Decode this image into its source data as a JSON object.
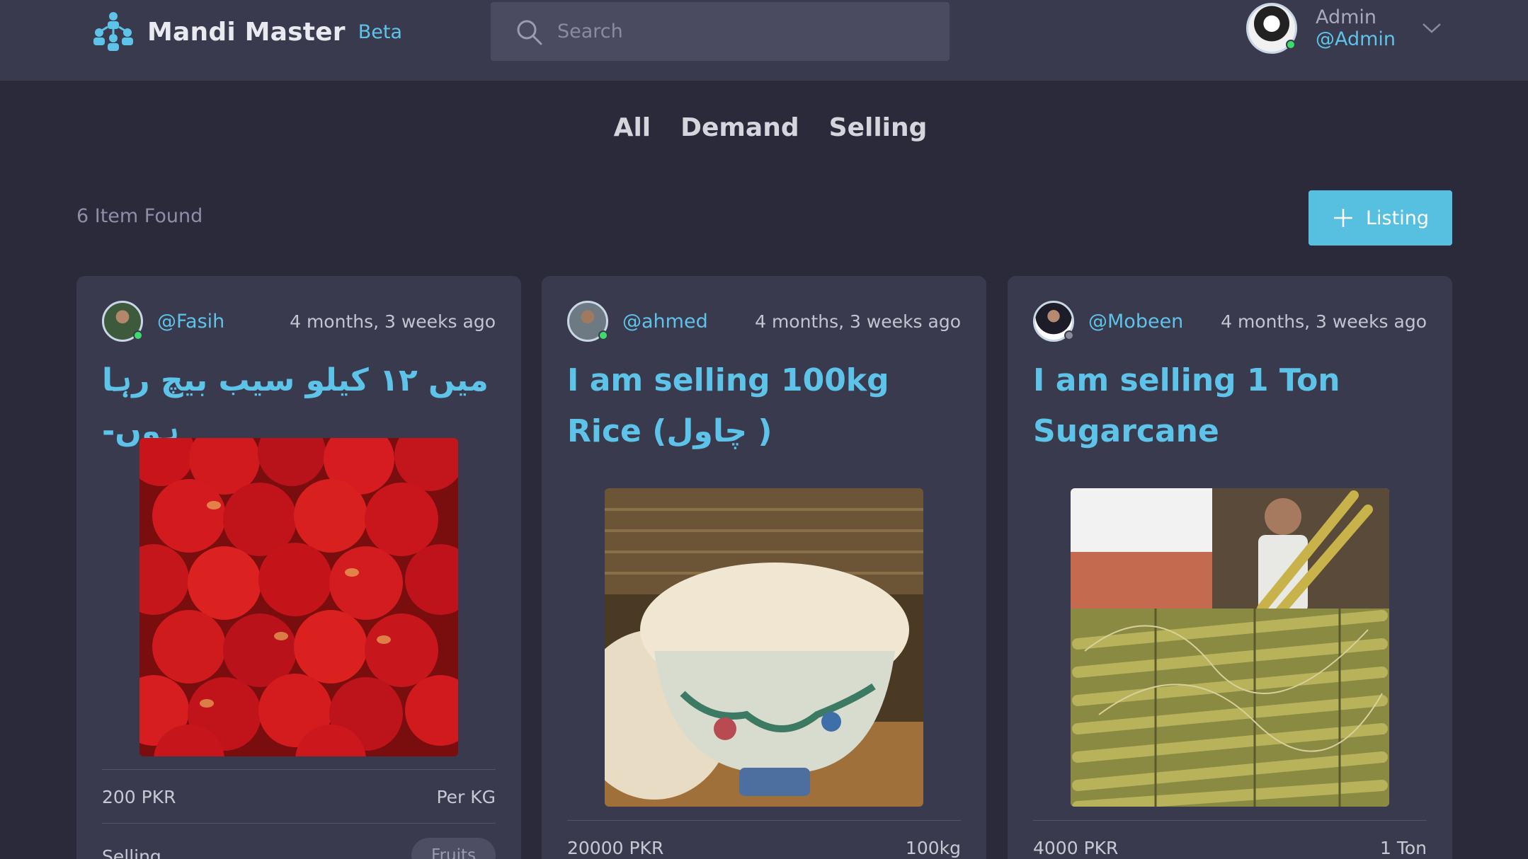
{
  "brand": {
    "name": "Mandi Master",
    "badge": "Beta",
    "logo_icon": "people-network-icon"
  },
  "search": {
    "placeholder": "Search",
    "value": ""
  },
  "user": {
    "name": "Admin",
    "handle": "@Admin",
    "status": "online"
  },
  "tabs": [
    {
      "label": "All"
    },
    {
      "label": "Demand"
    },
    {
      "label": "Selling"
    }
  ],
  "results": {
    "count_text": "6 Item Found"
  },
  "actions": {
    "listing_label": "Listing"
  },
  "colors": {
    "accent": "#5dc3e8",
    "background": "#2b2a3a",
    "surface": "#3a3a4f",
    "online": "#3ddc6a",
    "offline": "#8a8a99"
  },
  "cards": [
    {
      "handle": "@Fasih",
      "time": "4 months, 3 weeks ago",
      "online": true,
      "title": "میں ۱۲ کیلو سیب بیچ رہا ہوں-",
      "image": "red apples",
      "price": "200 PKR",
      "unit": "Per KG",
      "type": "Selling",
      "tag": "Fruits"
    },
    {
      "handle": "@ahmed",
      "time": "4 months, 3 weeks ago",
      "online": true,
      "title": "I am selling 100kg Rice (چاول )",
      "image": "rice bowl",
      "price": "20000 PKR",
      "unit": "100kg"
    },
    {
      "handle": "@Mobeen",
      "time": "4 months, 3 weeks ago",
      "online": false,
      "title": "I am selling 1 Ton Sugarcane",
      "image": "sugarcane bundles",
      "price": "4000 PKR",
      "unit": "1 Ton"
    }
  ]
}
